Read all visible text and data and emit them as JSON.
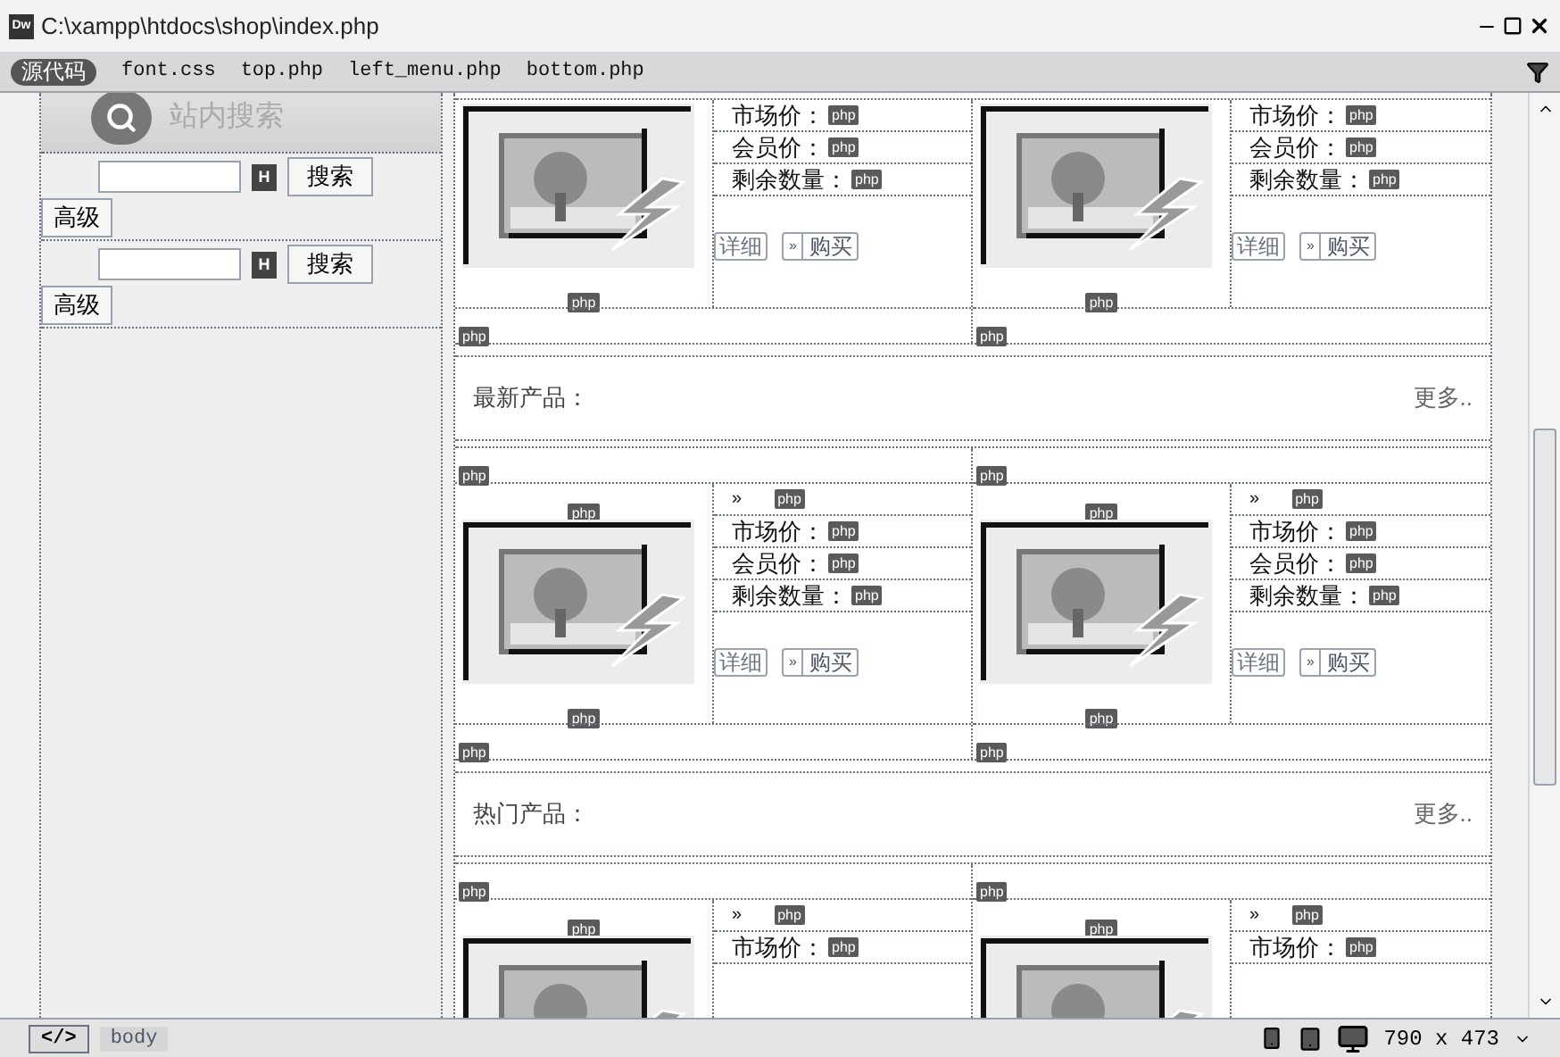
{
  "window": {
    "app_icon": "Dw",
    "title": "C:\\xampp\\htdocs\\shop\\index.php"
  },
  "toolbar": {
    "files": [
      {
        "label": "源代码",
        "selected": true
      },
      {
        "label": "font.css",
        "selected": false
      },
      {
        "label": "top.php",
        "selected": false
      },
      {
        "label": "left_menu.php",
        "selected": false
      },
      {
        "label": "bottom.php",
        "selected": false
      }
    ]
  },
  "sidebar": {
    "search_title": "站内搜索",
    "forms": [
      {
        "marker": "H",
        "button": "搜索",
        "advanced": "高级"
      },
      {
        "marker": "H",
        "button": "搜索",
        "advanced": "高级"
      }
    ]
  },
  "sections": [
    {
      "products": [
        {
          "fields": [
            {
              "label": "市场价：",
              "badge": "php"
            },
            {
              "label": "会员价：",
              "badge": "php"
            },
            {
              "label": "剩余数量：",
              "badge": "php"
            }
          ],
          "detail": "详细",
          "buy_icon": "»",
          "buy": "购买",
          "bottom_badge": "php",
          "footer_badge": "php"
        },
        {
          "fields": [
            {
              "label": "市场价：",
              "badge": "php"
            },
            {
              "label": "会员价：",
              "badge": "php"
            },
            {
              "label": "剩余数量：",
              "badge": "php"
            }
          ],
          "detail": "详细",
          "buy_icon": "»",
          "buy": "购买",
          "bottom_badge": "php",
          "footer_badge": "php"
        }
      ]
    },
    {
      "title": "最新产品：",
      "more": "更多..",
      "products": [
        {
          "row_badge": "php",
          "top_badge": "php",
          "arrow": "»",
          "name_badge": "php",
          "fields": [
            {
              "label": "市场价：",
              "badge": "php"
            },
            {
              "label": "会员价：",
              "badge": "php"
            },
            {
              "label": "剩余数量：",
              "badge": "php"
            }
          ],
          "detail": "详细",
          "buy_icon": "»",
          "buy": "购买",
          "bottom_badge": "php",
          "footer_badge": "php"
        },
        {
          "row_badge": "php",
          "top_badge": "php",
          "arrow": "»",
          "name_badge": "php",
          "fields": [
            {
              "label": "市场价：",
              "badge": "php"
            },
            {
              "label": "会员价：",
              "badge": "php"
            },
            {
              "label": "剩余数量：",
              "badge": "php"
            }
          ],
          "detail": "详细",
          "buy_icon": "»",
          "buy": "购买",
          "bottom_badge": "php",
          "footer_badge": "php"
        }
      ]
    },
    {
      "title": "热门产品：",
      "more": "更多..",
      "products": [
        {
          "row_badge": "php",
          "top_badge": "php",
          "arrow": "»",
          "name_badge": "php",
          "fields": [
            {
              "label": "市场价：",
              "badge": "php"
            }
          ]
        },
        {
          "row_badge": "php",
          "top_badge": "php",
          "arrow": "»",
          "name_badge": "php",
          "fields": [
            {
              "label": "市场价：",
              "badge": "php"
            }
          ]
        }
      ]
    }
  ],
  "status_bar": {
    "tag_button": "</>",
    "tag": "body",
    "size": "790 x 473"
  }
}
